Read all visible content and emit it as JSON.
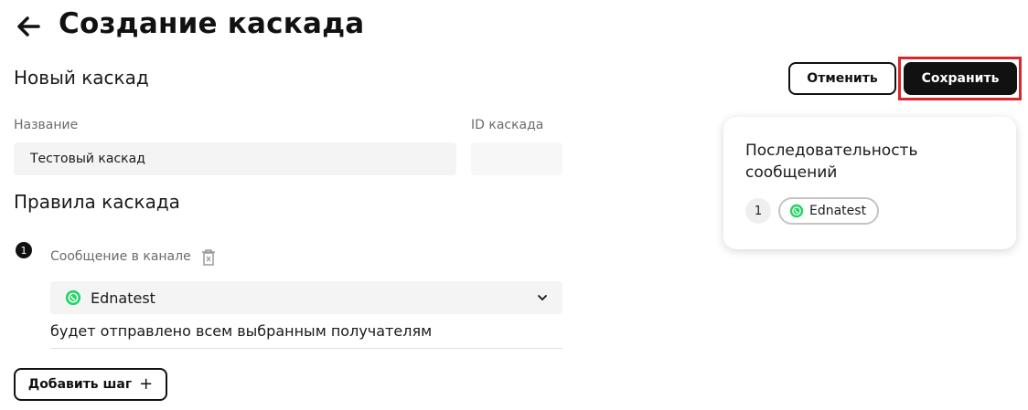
{
  "header": {
    "title": "Создание каскада",
    "back_icon": "arrow-left-icon"
  },
  "form": {
    "section_title": "Новый каскад",
    "name_label": "Название",
    "name_value": "Тестовый каскад",
    "id_label": "ID каскада",
    "id_value": ""
  },
  "rules": {
    "title": "Правила каскада",
    "steps": [
      {
        "number": "1",
        "label": "Сообщение в канале",
        "channel": "Ednatest",
        "channel_icon": "whatsapp-icon",
        "hint": "будет отправлено всем выбранным получателям"
      }
    ],
    "add_step_label": "Добавить шаг",
    "add_step_icon": "+"
  },
  "actions": {
    "cancel_label": "Отменить",
    "save_label": "Сохранить"
  },
  "sequence_card": {
    "title": "Последовательность сообщений",
    "items": [
      {
        "number": "1",
        "channel": "Ednatest",
        "icon": "whatsapp-icon"
      }
    ]
  },
  "colors": {
    "whatsapp": "#25D366",
    "primary_button": "#111111",
    "highlight_frame": "#d9262b"
  }
}
